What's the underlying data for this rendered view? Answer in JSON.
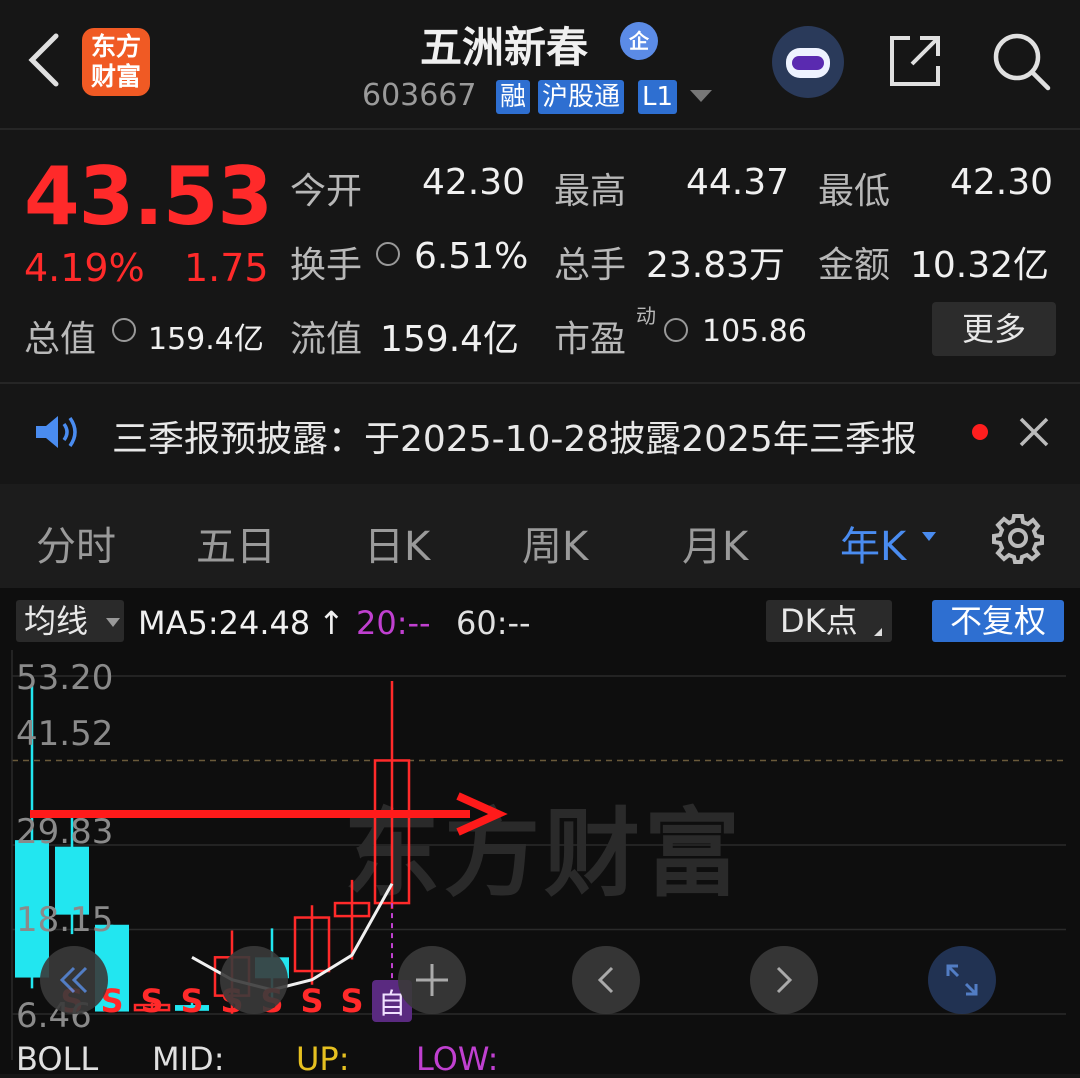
{
  "header": {
    "app_logo_line1": "东方",
    "app_logo_line2": "财富",
    "stock_name": "五洲新春",
    "qi_badge": "企",
    "stock_code": "603667",
    "tags": [
      "融",
      "沪股通",
      "L1"
    ]
  },
  "quote": {
    "price": "43.53",
    "change_pct": "4.19%",
    "change_abs": "1.75",
    "open_label": "今开",
    "open": "42.30",
    "high_label": "最高",
    "high": "44.37",
    "low_label": "最低",
    "low": "42.30",
    "turnover_label": "换手",
    "turnover": "6.51%",
    "volume_label": "总手",
    "volume": "23.83万",
    "amount_label": "金额",
    "amount": "10.32亿",
    "total_mv_label": "总值",
    "total_mv": "159.4亿",
    "float_mv_label": "流值",
    "float_mv": "159.4亿",
    "pe_label": "市盈",
    "pe_sup": "动",
    "pe": "105.86",
    "more_button": "更多"
  },
  "notice": {
    "text": "三季报预披露：于2025-10-28披露2025年三季报"
  },
  "tabs": [
    {
      "label": "分时"
    },
    {
      "label": "五日"
    },
    {
      "label": "日K"
    },
    {
      "label": "周K"
    },
    {
      "label": "月K"
    },
    {
      "label": "年K"
    }
  ],
  "chart_toolbar": {
    "indicator": "均线",
    "ma5": "MA5:24.48",
    "ma5_arrow": "↑",
    "ma20": "20:--",
    "ma60": "60:--",
    "dk_button": "DK点",
    "adjust_button": "不复权"
  },
  "chart_data": {
    "type": "candlestick",
    "title": "",
    "y_ticks": [
      "53.20",
      "41.52",
      "29.83",
      "18.15",
      "6.46"
    ],
    "ylim": [
      6.46,
      53.2
    ],
    "watermark": "东方财富",
    "candles": [
      {
        "open": 30.5,
        "close": 11.5,
        "high": 52,
        "low": 10,
        "color": "down"
      },
      {
        "open": 29.6,
        "close": 20.2,
        "high": 34,
        "low": 17.5,
        "color": "down"
      },
      {
        "open": 18.8,
        "close": 6.8,
        "high": 18.8,
        "low": 6.8,
        "color": "down"
      },
      {
        "open": 7.7,
        "close": 7.0,
        "high": 8.0,
        "low": 6.8,
        "color": "up"
      },
      {
        "open": 6.9,
        "close": 7.7,
        "high": 8.0,
        "low": 6.9,
        "color": "down"
      },
      {
        "open": 9.0,
        "close": 14.3,
        "high": 18.0,
        "low": 6.5,
        "color": "up"
      },
      {
        "open": 14.3,
        "close": 11.4,
        "high": 18.3,
        "low": 8.4,
        "color": "down"
      },
      {
        "open": 12.4,
        "close": 19.8,
        "high": 21.5,
        "low": 10.5,
        "color": "up"
      },
      {
        "open": 20.0,
        "close": 21.8,
        "high": 25.0,
        "low": 14.0,
        "color": "up"
      },
      {
        "open": 21.8,
        "close": 41.52,
        "high": 52.5,
        "low": 21.0,
        "color": "up"
      }
    ],
    "ma5_values": [
      null,
      null,
      null,
      null,
      14.3,
      11.2,
      9.8,
      11.2,
      14.6,
      24.48
    ],
    "ref_line": 41.52,
    "signals": [
      "S",
      "S",
      "S",
      "S",
      "S",
      "S",
      "S",
      "S",
      "自"
    ],
    "bottom_indicator": {
      "name": "BOLL",
      "mid": "MID:",
      "up": "UP:",
      "low": "LOW:"
    }
  },
  "colors": {
    "up": "#ff2a2a",
    "down": "#22e6f0",
    "accent": "#2e6fd1",
    "bg": "#161616"
  }
}
